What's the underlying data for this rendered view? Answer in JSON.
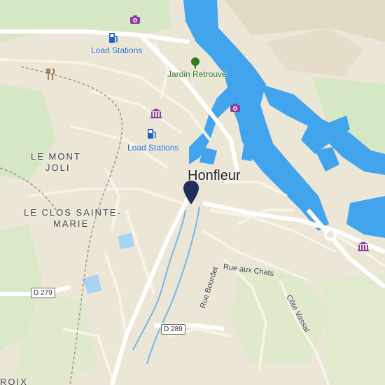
{
  "map": {
    "city": "Honfleur",
    "places": {
      "le_mont": "LE MONT",
      "joli": "JOLI",
      "clos_line1": "LE CLOS SAINTE-",
      "clos_line2": "MARIE",
      "bottom_left_fragment": "ROIX"
    },
    "pois": {
      "load_stations_top": "Load Stations",
      "load_stations_center": "Load Stations",
      "jardin": "Jardin Retrouvé"
    },
    "streets": {
      "rue_aux_chats": "Rue aux Chats",
      "rue_bourdet": "Rue Bourdet",
      "cote_vassal": "Côte Vassal"
    },
    "roads": {
      "d279": "D 279",
      "d289": "D 289"
    },
    "icons": [
      "museum-icon",
      "camera-icon",
      "fuel-icon",
      "restaurant-icon",
      "tree-icon",
      "location-pin-icon"
    ],
    "colors": {
      "water": "#43a4ee",
      "land": "#ece6d6",
      "park": "#d6e7c4",
      "poi_blue": "#1b62c4",
      "poi_purple": "#8a3ea0",
      "pin": "#1f2d5a"
    }
  }
}
